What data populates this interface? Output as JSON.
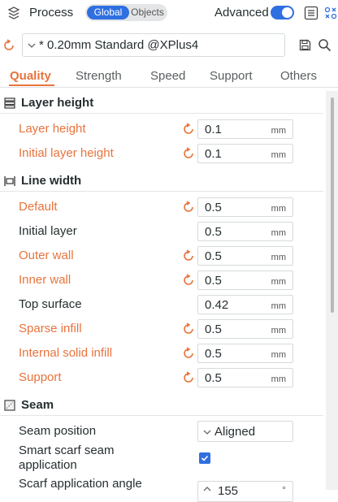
{
  "header": {
    "title": "Process",
    "toggle_global": "Global",
    "toggle_objects": "Objects",
    "advanced_label": "Advanced",
    "advanced_on": true
  },
  "preset": {
    "value": "* 0.20mm Standard @XPlus4"
  },
  "tabs": [
    {
      "label": "Quality",
      "active": true
    },
    {
      "label": "Strength"
    },
    {
      "label": "Speed"
    },
    {
      "label": "Support"
    },
    {
      "label": "Others"
    }
  ],
  "sections": {
    "layer_height": {
      "title": "Layer height",
      "rows": [
        {
          "label": "Layer height",
          "value": "0.1",
          "unit": "mm"
        },
        {
          "label": "Initial layer height",
          "value": "0.1",
          "unit": "mm"
        }
      ]
    },
    "line_width": {
      "title": "Line width",
      "rows": [
        {
          "label": "Default",
          "value": "0.5",
          "unit": "mm"
        },
        {
          "label": "Initial layer",
          "value": "0.5",
          "unit": "mm"
        },
        {
          "label": "Outer wall",
          "value": "0.5",
          "unit": "mm"
        },
        {
          "label": "Inner wall",
          "value": "0.5",
          "unit": "mm"
        },
        {
          "label": "Top surface",
          "value": "0.42",
          "unit": "mm"
        },
        {
          "label": "Sparse infill",
          "value": "0.5",
          "unit": "mm"
        },
        {
          "label": "Internal solid infill",
          "value": "0.5",
          "unit": "mm"
        },
        {
          "label": "Support",
          "value": "0.5",
          "unit": "mm"
        }
      ]
    },
    "seam": {
      "title": "Seam",
      "seam_position_label": "Seam position",
      "seam_position_value": "Aligned",
      "smart_scarf_label_1": "Smart scarf seam",
      "smart_scarf_label_2": "application",
      "smart_scarf_checked": true,
      "scarf_angle_label": "Scarf application angle",
      "scarf_angle_value": "155",
      "scarf_angle_unit": "°"
    }
  },
  "colors": {
    "accent": "#2f6fe0",
    "modified": "#e8733c"
  }
}
